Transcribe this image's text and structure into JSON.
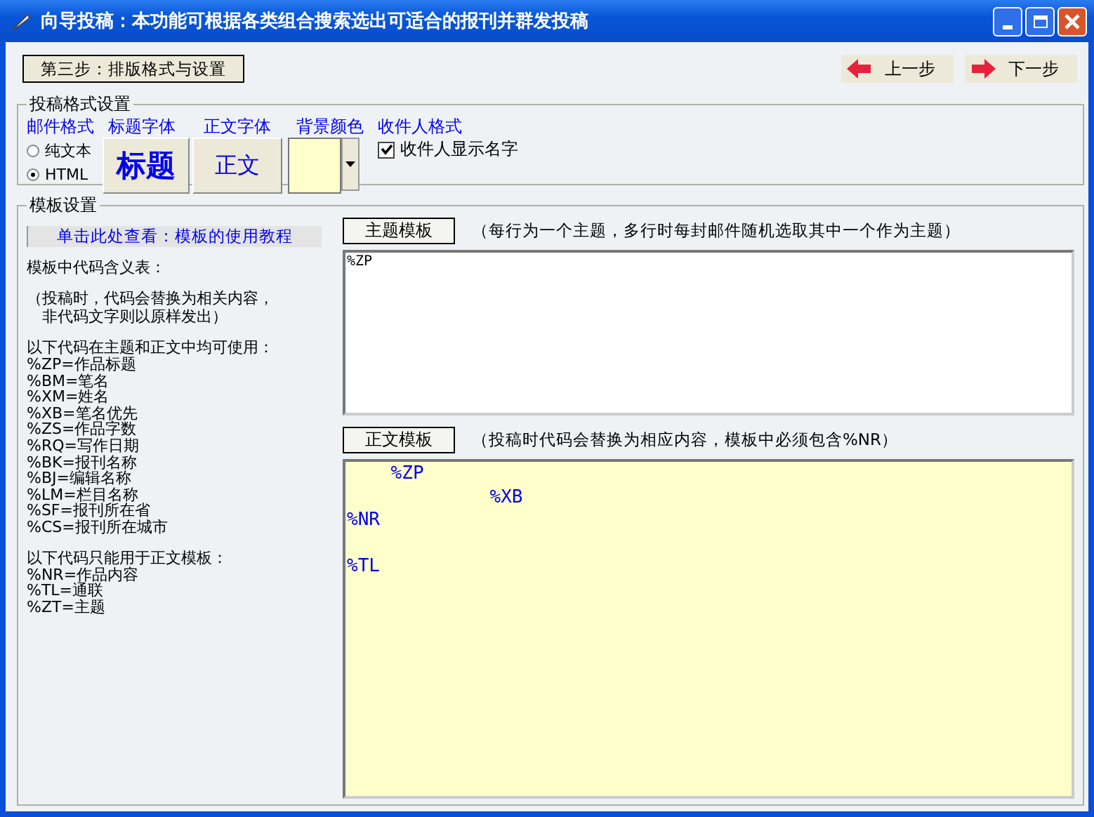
{
  "window": {
    "title": "向导投稿：本功能可根据各类组合搜索选出可适合的报刊并群发投稿"
  },
  "step": "第三步：排版格式与设置",
  "nav": [
    {
      "label": "上一步",
      "kind": "back"
    },
    {
      "label": "下一步",
      "kind": "next"
    }
  ],
  "format": {
    "legend": "投稿格式设置",
    "mail_format": {
      "label": "邮件格式",
      "options": [
        {
          "label": "纯文本",
          "selected": false
        },
        {
          "label": "HTML",
          "selected": true
        }
      ]
    },
    "title_font": {
      "label": "标题字体",
      "sample": "标题"
    },
    "body_font": {
      "label": "正文字体",
      "sample": "正文"
    },
    "background": {
      "label": "背景颜色",
      "color": "#ffffcc"
    },
    "recipient": {
      "label": "收件人格式",
      "option": "收件人显示名字",
      "checked": true
    }
  },
  "template": {
    "legend": "模板设置",
    "link": "单击此处查看：模板的使用教程",
    "table_title": "模板中代码含义表：",
    "note": [
      "（投稿时，代码会替换为相关内容，",
      "非代码文字则以原样发出）"
    ],
    "sections": [
      {
        "heading": "以下代码在主题和正文中均可使用：",
        "codes": [
          "%ZP=作品标题",
          "%BM=笔名",
          "%XM=姓名",
          "%XB=笔名优先",
          "%ZS=作品字数",
          "%RQ=写作日期",
          "%BK=报刊名称",
          "%BJ=编辑名称",
          "%LM=栏目名称",
          "%SF=报刊所在省",
          "%CS=报刊所在城市"
        ]
      },
      {
        "heading": "以下代码只能用于正文模板：",
        "codes": [
          "%NR=作品内容",
          "%TL=通联",
          "%ZT=主题"
        ]
      }
    ],
    "subject": {
      "button": "主题模板",
      "hint": "（每行为一个主题，多行时每封邮件随机选取其中一个作为主题）",
      "value": "%ZP"
    },
    "body": {
      "button": "正文模板",
      "hint": "（投稿时代码会替换为相应内容，模板中必须包含%NR）",
      "value": "    %ZP\n             %XB\n%NR\n\n%TL"
    }
  }
}
